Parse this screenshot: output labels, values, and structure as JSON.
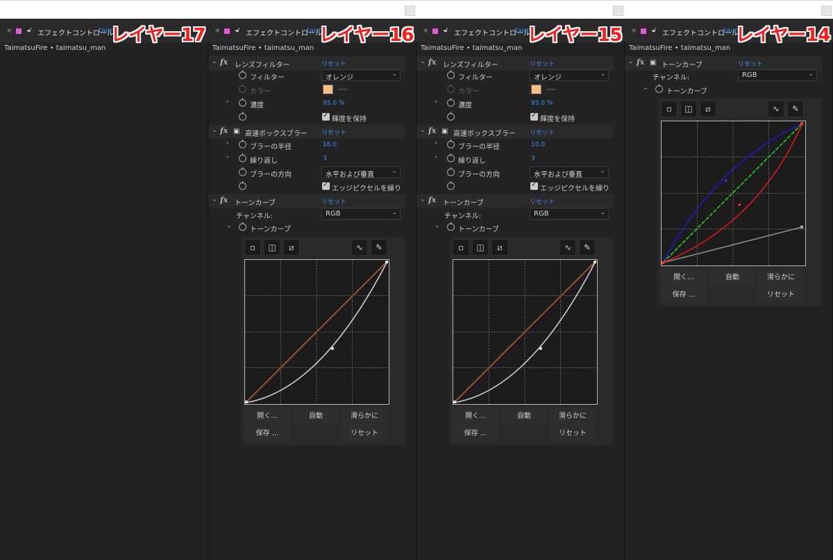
{
  "panels": [
    {
      "layer": "レイヤー17",
      "tab_title": "エフェクトコントロール",
      "tab_link": "taim",
      "breadcrumb": "TaimatsuFire • taimatsu_man"
    },
    {
      "layer": "レイヤー16",
      "tab_title": "エフェクトコントロール",
      "tab_link": "taim",
      "breadcrumb": "TaimatsuFire • taimatsu_man",
      "lens": {
        "name": "レンズフィルター",
        "reset": "リセット",
        "filter_label": "フィルター",
        "filter_value": "オレンジ",
        "color_label": "カラー",
        "density_label": "濃度",
        "density_value": "95.0 %",
        "preserve_label": "輝度を保持"
      },
      "blur": {
        "name": "高速ボックスブラー",
        "reset": "リセット",
        "radius_label": "ブラーの半径",
        "radius_value": "16.0",
        "iter_label": "繰り返し",
        "iter_value": "3",
        "dir_label": "ブラーの方向",
        "dir_value": "水平および垂直",
        "edge_label": "エッジピクセルを繰り"
      },
      "curves": {
        "name": "トーンカーブ",
        "reset": "リセット",
        "channel_label": "チャンネル:",
        "channel_value": "RGB",
        "curve_label": "トーンカーブ",
        "btn_open": "開く...",
        "btn_auto": "自動",
        "btn_smooth": "滑らかに",
        "btn_save": "保存 ...",
        "btn_reset": "リセット"
      }
    },
    {
      "layer": "レイヤー15",
      "tab_title": "エフェクトコントロール",
      "tab_link": "taim",
      "breadcrumb": "TaimatsuFire • taimatsu_man",
      "lens": {
        "name": "レンズフィルター",
        "reset": "リセット",
        "filter_label": "フィルター",
        "filter_value": "オレンジ",
        "color_label": "カラー",
        "density_label": "濃度",
        "density_value": "95.0 %",
        "preserve_label": "輝度を保持"
      },
      "blur": {
        "name": "高速ボックスブラー",
        "reset": "リセット",
        "radius_label": "ブラーの半径",
        "radius_value": "10.0",
        "iter_label": "繰り返し",
        "iter_value": "3",
        "dir_label": "ブラーの方向",
        "dir_value": "水平および垂直",
        "edge_label": "エッジピクセルを繰り"
      },
      "curves": {
        "name": "トーンカーブ",
        "reset": "リセット",
        "channel_label": "チャンネル:",
        "channel_value": "RGB",
        "curve_label": "トーンカーブ",
        "btn_open": "開く...",
        "btn_auto": "自動",
        "btn_smooth": "滑らかに",
        "btn_save": "保存 ...",
        "btn_reset": "リセット"
      }
    },
    {
      "layer": "レイヤー14",
      "tab_title": "エフェクトコントロール",
      "tab_link": "taim",
      "breadcrumb": "TaimatsuFire • taimatsu_man",
      "curves": {
        "name": "トーンカーブ",
        "reset": "リセット",
        "channel_label": "チャンネル:",
        "channel_value": "RGB",
        "curve_label": "トーンカーブ",
        "btn_open": "開く...",
        "btn_auto": "自動",
        "btn_smooth": "滑らかに",
        "btn_save": "保存 ...",
        "btn_reset": "リセット"
      }
    }
  ],
  "colors": {
    "accent": "#3b8ef0",
    "layer_label": "#ff1a1a",
    "swatch": "#f7bd83",
    "panel_bg": "#232323",
    "tab_square": "#e15bd8"
  },
  "icons": [
    "close-icon",
    "layer-color-square",
    "lock-icon",
    "stopwatch-icon",
    "chevron-icon",
    "eyedropper-icon",
    "pencil-icon",
    "curve-tool-icon"
  ]
}
